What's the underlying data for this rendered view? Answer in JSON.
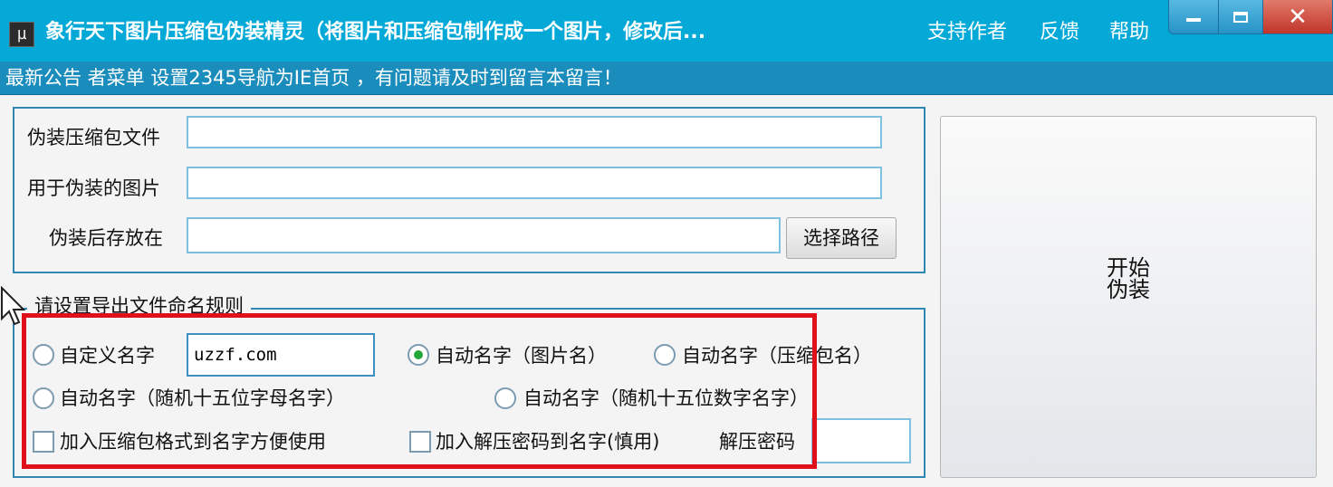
{
  "window": {
    "app_icon_glyph": "µ",
    "title": "象行天下图片压缩包伪装精灵（将图片和压缩包制作成一个图片，修改后...",
    "links": [
      "支持作者",
      "反馈",
      "帮助"
    ],
    "controls": {
      "minimize": "minimize-icon",
      "maximize": "maximize-icon",
      "close": "✕"
    }
  },
  "announcement": "最新公告 者菜单 设置2345导航为IE首页 ，有问题请及时到留言本留言！",
  "files": {
    "archive_label": "伪装压缩包文件",
    "archive_value": "",
    "image_label": "用于伪装的图片",
    "image_value": "",
    "output_label": "伪装后存放在",
    "output_value": "",
    "browse_button": "选择路径"
  },
  "start_button": "开始伪装",
  "naming": {
    "group_title": "请设置导出文件命名规则",
    "custom_name_label": "自定义名字",
    "custom_name_value": "uzzf.com",
    "auto_image_label": "自动名字（图片名）",
    "auto_archive_label": "自动名字（压缩包名）",
    "random_letters_label": "自动名字（随机十五位字母名字）",
    "random_digits_label": "自动名字（随机十五位数字名字）",
    "selected": "auto_image",
    "add_format_label": "加入压缩包格式到名字方便使用",
    "add_format_checked": false,
    "add_password_label": "加入解压密码到名字(慎用)",
    "add_password_checked": false,
    "password_label": "解压密码",
    "password_value": ""
  },
  "colors": {
    "titlebar": "#04a9d8",
    "announcement_bar": "#1b8dbd",
    "group_border": "#2f87b4",
    "highlight": "#e0101a",
    "radio_selected": "#22a83a"
  }
}
